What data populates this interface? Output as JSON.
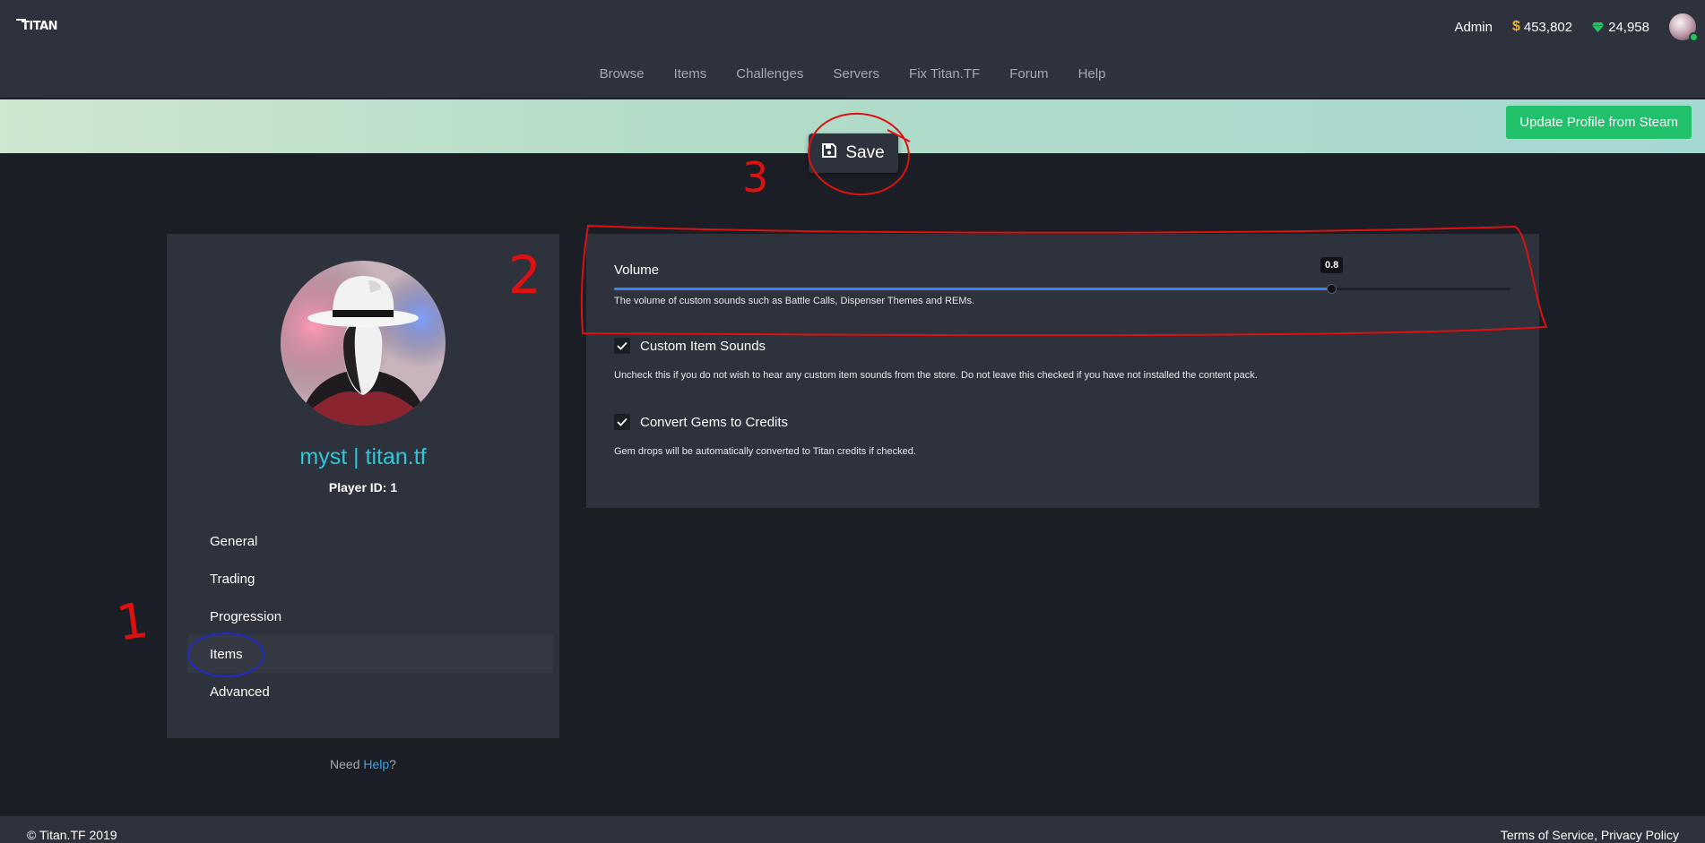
{
  "header": {
    "logo_text": "TITAN",
    "user_name": "Admin",
    "credits_symbol": "$",
    "credits": "453,802",
    "gems": "24,958",
    "accent_gem": "#22c55e",
    "accent_credits": "#f2b31b"
  },
  "nav": {
    "items": [
      "Browse",
      "Items",
      "Challenges",
      "Servers",
      "Fix Titan.TF",
      "Forum",
      "Help"
    ]
  },
  "banner": {
    "update_button": "Update Profile from Steam",
    "save_button": "Save"
  },
  "profile": {
    "name": "myst | titan.tf",
    "player_id": "Player ID: 1",
    "menu": [
      {
        "label": "General",
        "active": false
      },
      {
        "label": "Trading",
        "active": false
      },
      {
        "label": "Progression",
        "active": false
      },
      {
        "label": "Items",
        "active": true
      },
      {
        "label": "Advanced",
        "active": false
      }
    ],
    "help_prefix": "Need ",
    "help_link": "Help",
    "help_suffix": "?"
  },
  "settings": {
    "volume": {
      "label": "Volume",
      "value": 0.8,
      "value_text": "0.8",
      "description": "The volume of custom sounds such as Battle Calls, Dispenser Themes and REMs."
    },
    "custom_item_sounds": {
      "label": "Custom Item Sounds",
      "checked": true,
      "description": "Uncheck this if you do not wish to hear any custom item sounds from the store. Do not leave this checked if you have not installed the content pack."
    },
    "convert_gems": {
      "label": "Convert Gems to Credits",
      "checked": true,
      "description": "Gem drops will be automatically converted to Titan credits if checked."
    }
  },
  "annotations": {
    "marker_1": "1",
    "marker_2": "2",
    "marker_3": "3"
  },
  "footer": {
    "copyright": "© Titan.TF 2019",
    "links": "Terms of Service, Privacy Policy"
  }
}
